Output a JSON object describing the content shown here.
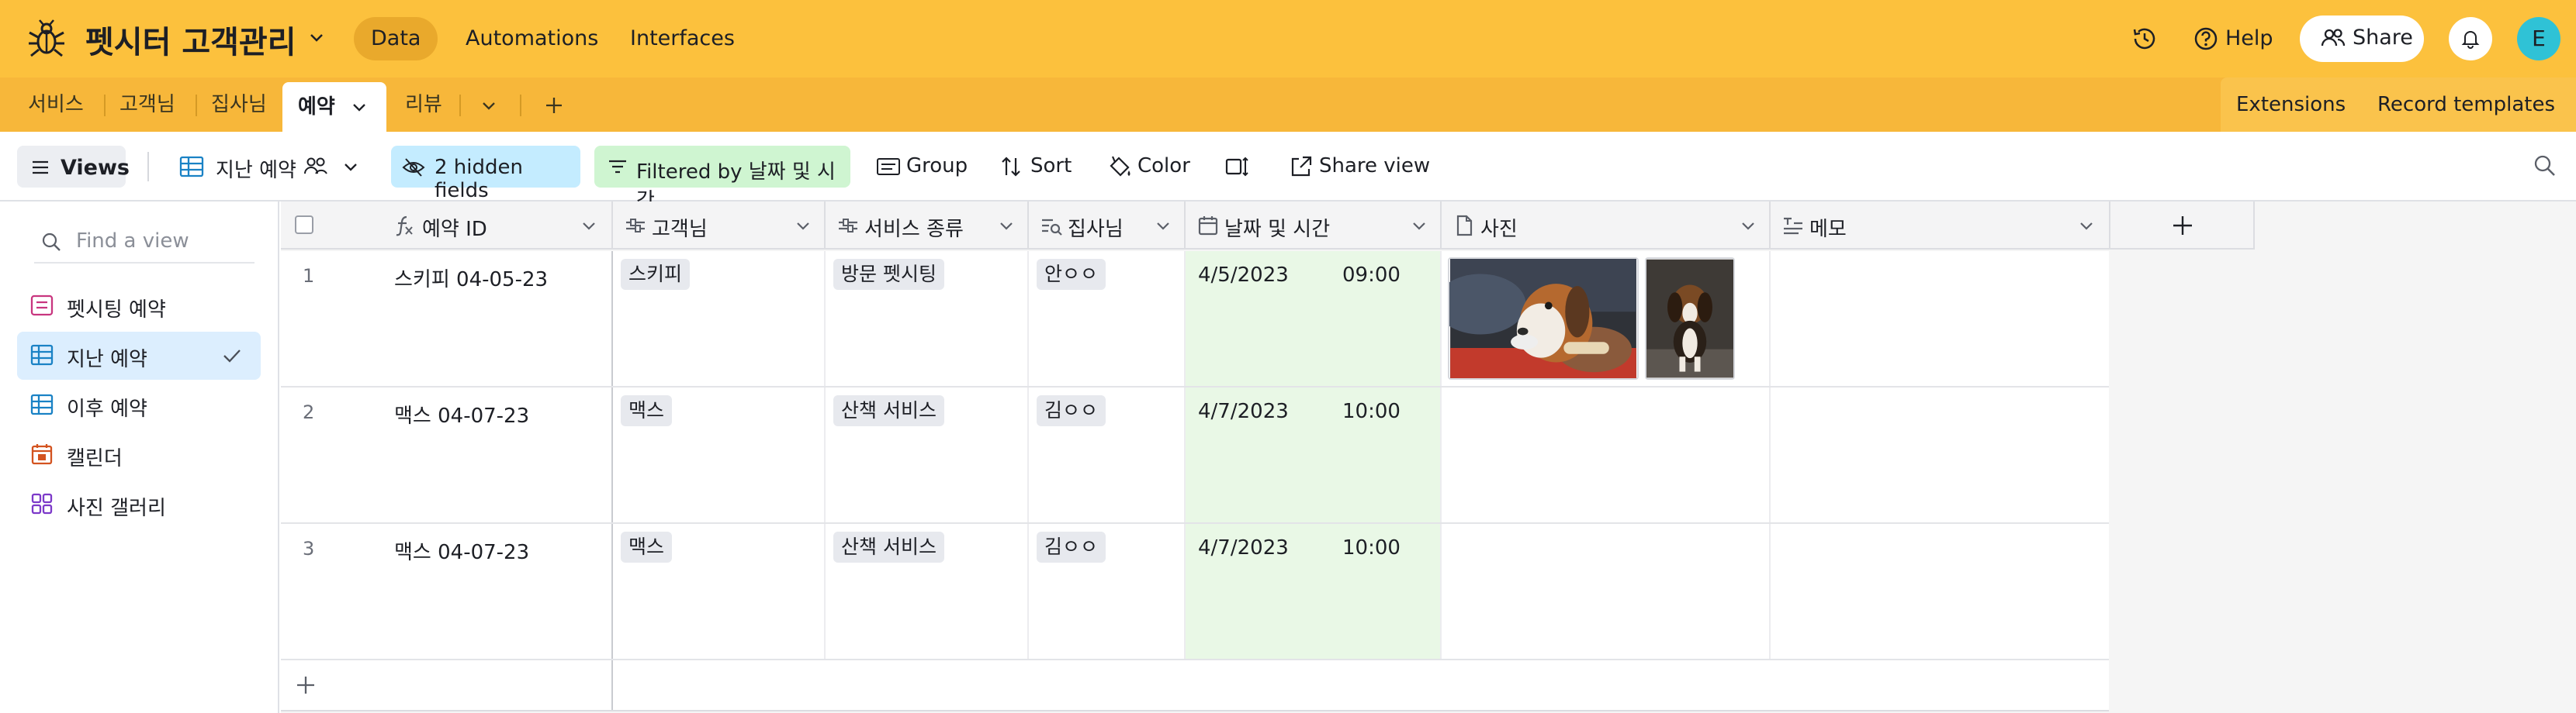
{
  "app": {
    "base_name": "펫시터 고객관리",
    "nav": [
      "Data",
      "Automations",
      "Interfaces"
    ],
    "help_label": "Help",
    "share_label": "Share",
    "avatar_initial": "E"
  },
  "tabs": {
    "items": [
      "서비스",
      "고객님",
      "집사님",
      "예약",
      "리뷰"
    ],
    "active": "예약",
    "extensions_label": "Extensions",
    "record_templates_label": "Record templates"
  },
  "viewbar": {
    "views_label": "Views",
    "current_view": "지난 예약",
    "hidden_fields": "2 hidden fields",
    "filter": "Filtered by 날짜 및 시간",
    "group": "Group",
    "sort": "Sort",
    "color": "Color",
    "share_view": "Share view"
  },
  "sidebar": {
    "find_placeholder": "Find a view",
    "items": [
      {
        "label": "펫시팅 예약",
        "icon": "form-icon"
      },
      {
        "label": "지난 예약",
        "icon": "grid-icon"
      },
      {
        "label": "이후 예약",
        "icon": "grid-icon"
      },
      {
        "label": "캘린더",
        "icon": "calendar-icon"
      },
      {
        "label": "사진 갤러리",
        "icon": "gallery-icon"
      }
    ],
    "selected": "지난 예약"
  },
  "columns": [
    "예약 ID",
    "고객님",
    "서비스 종류",
    "집사님",
    "날짜 및 시간",
    "사진",
    "메모"
  ],
  "rows": [
    {
      "num": "1",
      "id": "스키피 04-05-23",
      "customer": "스키피",
      "service": "방문 펫시팅",
      "sitter": "안ㅇㅇ",
      "date": "4/5/2023",
      "time": "09:00",
      "photos": 2
    },
    {
      "num": "2",
      "id": "맥스 04-07-23",
      "customer": "맥스",
      "service": "산책 서비스",
      "sitter": "김ㅇㅇ",
      "date": "4/7/2023",
      "time": "10:00",
      "photos": 0
    },
    {
      "num": "3",
      "id": "맥스 04-07-23",
      "customer": "맥스",
      "service": "산책 서비스",
      "sitter": "김ㅇㅇ",
      "date": "4/7/2023",
      "time": "10:00",
      "photos": 0
    }
  ],
  "colors": {
    "topbar": "#fcc13d",
    "tabsbar": "#f7b73a",
    "date_column": "#e9f8e6",
    "hidden_fields_chip": "#c4ecff",
    "filter_chip": "#cff5d1",
    "selected_view": "#dceefe"
  }
}
